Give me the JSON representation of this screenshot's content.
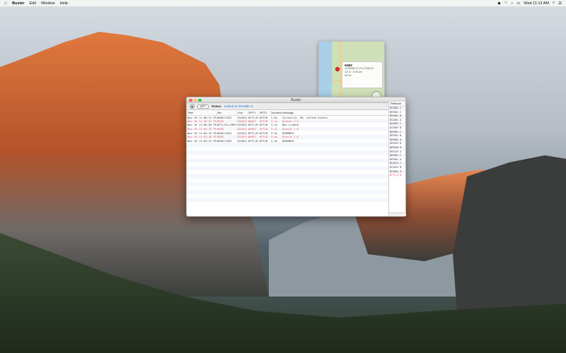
{
  "menubar": {
    "apple": "",
    "app_name": "Buster",
    "items": [
      "Edit",
      "Window",
      "Help"
    ],
    "clock": "Wed 11:13 AM"
  },
  "map": {
    "card_title": "N4BZ",
    "card_lines": [
      "44.55983 N 123.27983 W",
      "1/2 in · 8:26 am",
      "55 Hz"
    ],
    "legal": "Legal"
  },
  "window": {
    "title": "Buster",
    "toolbar": {
      "btn_label": "APT",
      "status_label": "Status",
      "status_value": "Linked to W7UBC-3"
    },
    "columns": [
      "Time",
      "Me",
      "Your",
      "RPT1",
      "RPT2",
      "Duration",
      "Message"
    ],
    "rows": [
      {
        "time": "Nov 16 11:06:21 PST",
        "me": "N4BZ/ZIDI",
        "your": "CQCQCQ",
        "rpt1": "W7TL/B",
        "rpt2": "W7TLB",
        "dur": "2.6s",
        "msg": "DORONEH",
        "err": false
      },
      {
        "time": "Nov 16 11:06:53 PST",
        "me": "N4BZ",
        "your": "CQCQCQ",
        "rpt1": "W6KEY",
        "rpt2": "W7TLB",
        "dur": "3.1s",
        "msg": "Queste 1.6",
        "err": true
      },
      {
        "time": "Nov 16 11:06:04 PST",
        "me": "W7TL/DL/ZNYS",
        "your": "CQCQCQ",
        "rpt1": "W7TL/B",
        "rpt2": "W7TLB",
        "dur": "3.2s",
        "msg": "Not Linked",
        "err": false
      },
      {
        "time": "Nov 16 11:04:32 PST",
        "me": "N4BZ",
        "your": "CQCQCQ",
        "rpt1": "W6KEY",
        "rpt2": "W7TLB",
        "dur": "3.1s",
        "msg": "Queste 1.6",
        "err": true
      },
      {
        "time": "Nov 16 11:04:15 PST",
        "me": "N4BZ/ZIDI",
        "your": "CQCQCQ",
        "rpt1": "W7TL/B",
        "rpt2": "W7TLB",
        "dur": "3.5s",
        "msg": "DORONEH",
        "err": false
      },
      {
        "time": "Nov 16 11:03:58 PST",
        "me": "N4BZ",
        "your": "CQCQCQ",
        "rpt1": "W6KEY",
        "rpt2": "W7TLB",
        "dur": "3.0s",
        "msg": "Queste 1.6",
        "err": true
      },
      {
        "time": "Nov 16 11:03:31 PST",
        "me": "N4BZ/ZIDI",
        "your": "CQCQCQ",
        "rpt1": "W7TL/B",
        "rpt2": "W7TLB",
        "dur": "3.3s",
        "msg": "DORONEH",
        "err": false
      }
    ],
    "location_text": "Corvallis, OR, United States",
    "sidebar_head": "Reflector",
    "sidebar_items": [
      "DCS001 C",
      "REF001 C",
      "REF001 B",
      "DCS001 A",
      "DCS007 C",
      "DCS007 B",
      "REF001 C",
      "REF001 B",
      "REF001 A",
      "REF029 B",
      "REF030 B",
      "REF029 A",
      "REF001 C",
      "REF001 A",
      "DCS013 C",
      "DCS013 B",
      "DCS001 A",
      "W7TL/B B"
    ]
  }
}
